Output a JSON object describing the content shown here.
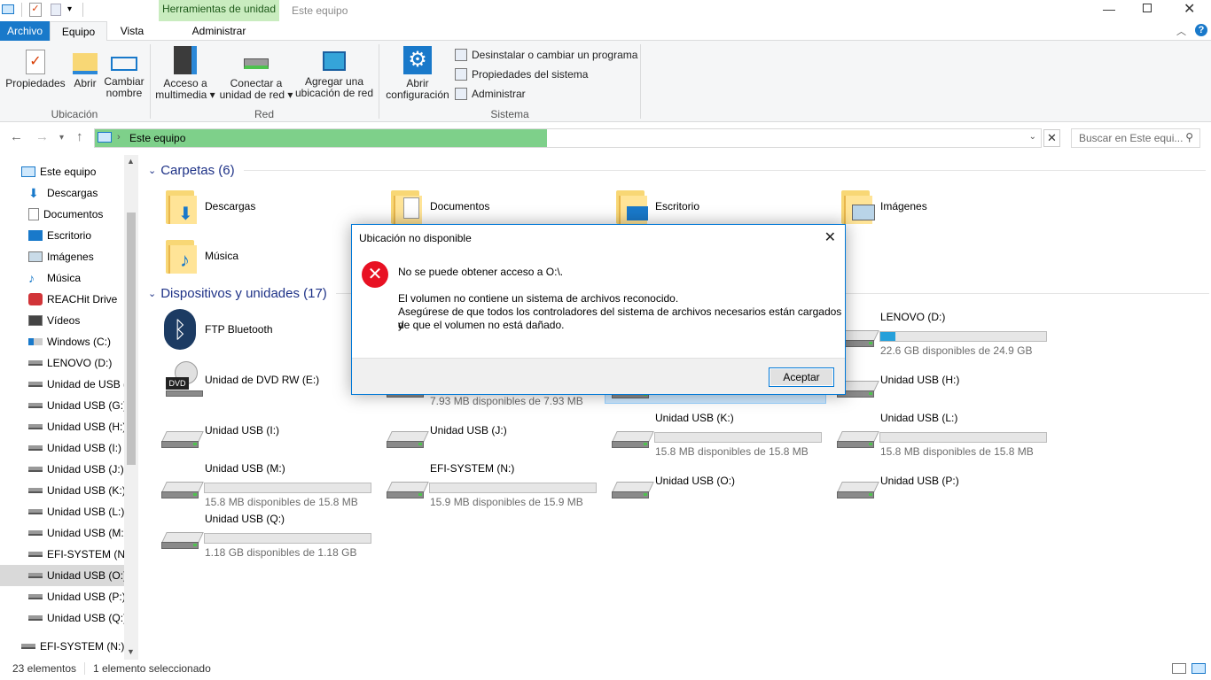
{
  "window": {
    "contextual_tab": "Herramientas de unidad",
    "title": "Este equipo"
  },
  "tabs": {
    "file": "Archivo",
    "computer": "Equipo",
    "view": "Vista",
    "manage": "Administrar"
  },
  "ribbon": {
    "location_group": "Ubicación",
    "network_group": "Red",
    "system_group": "Sistema",
    "properties": "Propiedades",
    "open": "Abrir",
    "rename_line1": "Cambiar",
    "rename_line2": "nombre",
    "media_line1": "Acceso a",
    "media_line2": "multimedia",
    "map_line1": "Conectar a",
    "map_line2": "unidad de red",
    "add_line1": "Agregar una",
    "add_line2": "ubicación de red",
    "settings_line1": "Abrir",
    "settings_line2": "configuración",
    "uninstall": "Desinstalar o cambiar un programa",
    "sys_props": "Propiedades del sistema",
    "manage": "Administrar"
  },
  "address": {
    "path": "Este equipo",
    "search_placeholder": "Buscar en Este equi..."
  },
  "nav": [
    {
      "label": "Este equipo",
      "icon": "computer-icon"
    },
    {
      "label": "Descargas",
      "icon": "downloads-icon"
    },
    {
      "label": "Documentos",
      "icon": "documents-icon"
    },
    {
      "label": "Escritorio",
      "icon": "desktop-icon"
    },
    {
      "label": "Imágenes",
      "icon": "pictures-icon"
    },
    {
      "label": "Música",
      "icon": "music-icon"
    },
    {
      "label": "REACHit Drive",
      "icon": "reachit-icon"
    },
    {
      "label": "Vídeos",
      "icon": "videos-icon"
    },
    {
      "label": "Windows (C:)",
      "icon": "windows-drive-icon"
    },
    {
      "label": "LENOVO (D:)",
      "icon": "drive-icon"
    },
    {
      "label": "Unidad de USB (",
      "icon": "drive-icon"
    },
    {
      "label": "Unidad USB (G:)",
      "icon": "drive-icon"
    },
    {
      "label": "Unidad USB (H:)",
      "icon": "drive-icon"
    },
    {
      "label": "Unidad USB (I:)",
      "icon": "drive-icon"
    },
    {
      "label": "Unidad USB (J:)",
      "icon": "drive-icon"
    },
    {
      "label": "Unidad USB (K:)",
      "icon": "drive-icon"
    },
    {
      "label": "Unidad USB (L:)",
      "icon": "drive-icon"
    },
    {
      "label": "Unidad USB (M:)",
      "icon": "drive-icon"
    },
    {
      "label": "EFI-SYSTEM (N:)",
      "icon": "drive-icon"
    },
    {
      "label": "Unidad USB (O:)",
      "icon": "drive-icon"
    },
    {
      "label": "Unidad USB (P:)",
      "icon": "drive-icon"
    },
    {
      "label": "Unidad USB (Q:)",
      "icon": "drive-icon"
    },
    {
      "label": "EFI-SYSTEM (N:)",
      "icon": "drive-icon"
    }
  ],
  "sections": {
    "folders": "Carpetas (6)",
    "devices": "Dispositivos y unidades (17)"
  },
  "folders": [
    {
      "label": "Descargas"
    },
    {
      "label": "Documentos"
    },
    {
      "label": "Escritorio"
    },
    {
      "label": "Imágenes"
    },
    {
      "label": "Música"
    }
  ],
  "devices": [
    {
      "label": "FTP Bluetooth",
      "icon": "bluetooth-icon"
    },
    {
      "label": "LENOVO (D:)",
      "free": "22.6 GB disponibles de 24.9 GB",
      "used_fraction": 0.09
    },
    {
      "label": "Unidad de DVD RW (E:)",
      "icon": "dvd-icon"
    },
    {
      "label": "Unidad USB (H:)"
    },
    {
      "label": "Unidad USB (I:)"
    },
    {
      "label": "Unidad USB (J:)"
    },
    {
      "label": "Unidad USB (K:)",
      "free": "15.8 MB disponibles de 15.8 MB",
      "used_fraction": 0
    },
    {
      "label": "Unidad USB (L:)",
      "free": "15.8 MB disponibles de 15.8 MB",
      "used_fraction": 0
    },
    {
      "label": "Unidad USB (M:)",
      "free": "15.8 MB disponibles de 15.8 MB",
      "used_fraction": 0
    },
    {
      "label": "EFI-SYSTEM (N:)",
      "free": "15.9 MB disponibles de 15.9 MB",
      "used_fraction": 0
    },
    {
      "label": "Unidad USB (O:)"
    },
    {
      "label": "Unidad USB (P:)"
    },
    {
      "label": "Unidad USB (Q:)",
      "free": "1.18 GB disponibles de 1.18 GB",
      "used_fraction": 0
    }
  ],
  "hidden_partial_text": "7.93 MB disponibles de 7.93 MB",
  "status": {
    "count": "23 elementos",
    "selection": "1 elemento seleccionado"
  },
  "dialog": {
    "title": "Ubicación no disponible",
    "line1": "No se puede obtener acceso a O:\\.",
    "line2": "El volumen no contiene un sistema de archivos reconocido.",
    "line3": "Asegúrese de que todos los controladores del sistema de archivos necesarios están cargados y",
    "line4": "de que el volumen no está dañado.",
    "ok": "Aceptar"
  },
  "colors": {
    "accent": "#0078d7",
    "address_highlight": "#7ed08a",
    "contextual_tab": "#c9ecbf",
    "error": "#e81123"
  }
}
